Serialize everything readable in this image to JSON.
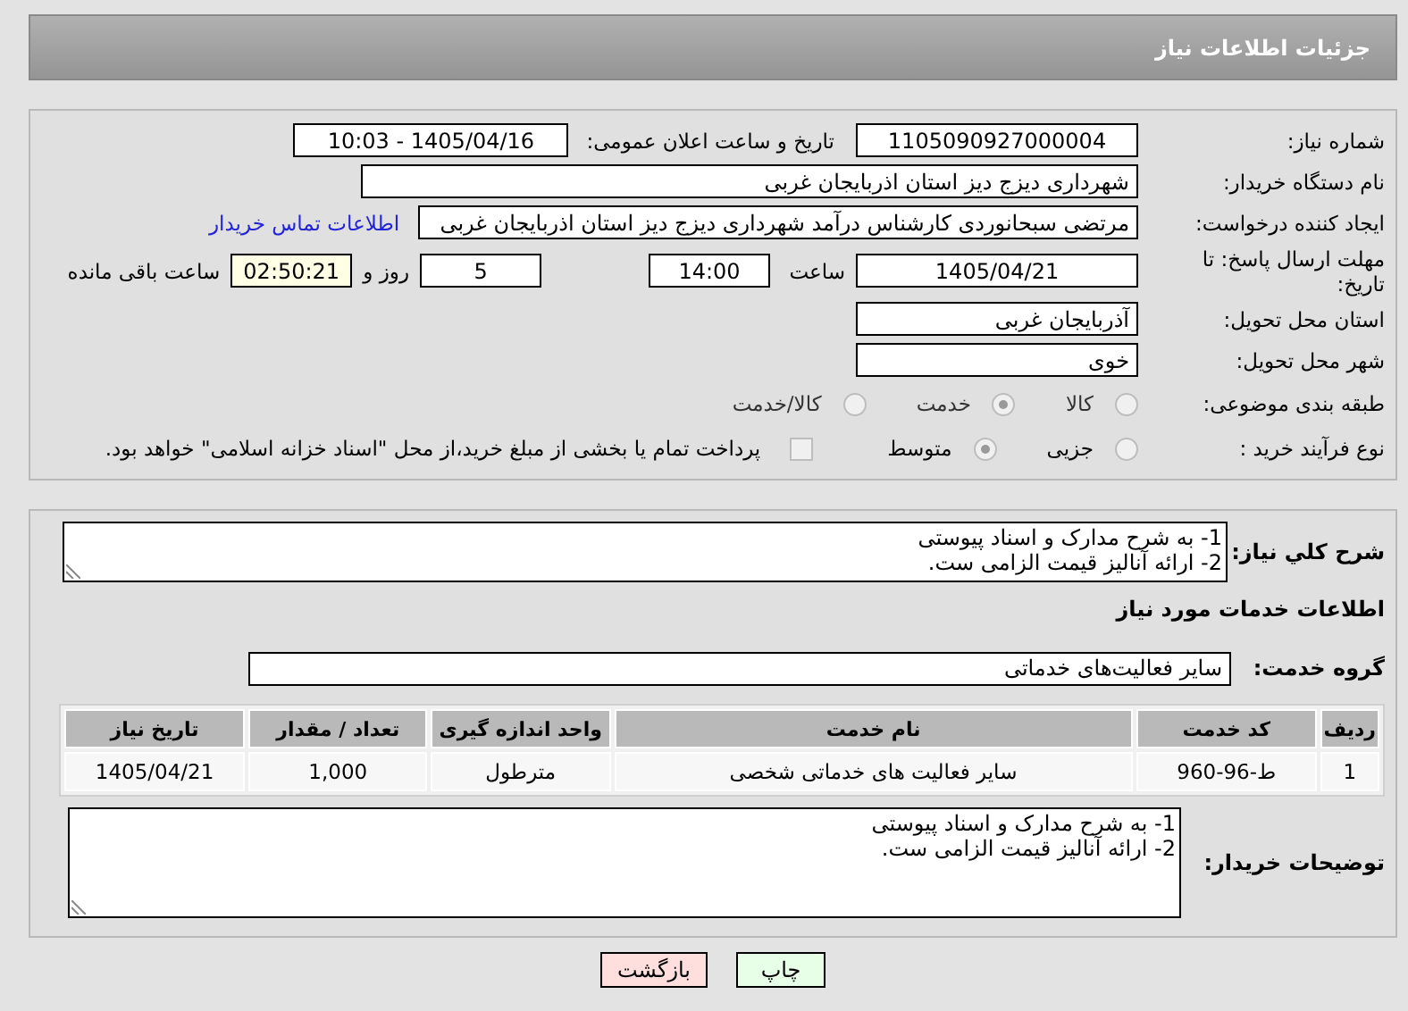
{
  "header": {
    "title": "جزئیات اطلاعات نیاز"
  },
  "need_number": {
    "label": "شماره نیاز:",
    "value": "1105090927000004"
  },
  "announce": {
    "label": "تاریخ و ساعت اعلان عمومی:",
    "value": "1405/04/16 - 10:03"
  },
  "buyer_org": {
    "label": "نام دستگاه خریدار:",
    "value": "شهرداری دیزج دیز استان اذربایجان غربی"
  },
  "creator": {
    "label": "ایجاد کننده درخواست:",
    "value": "مرتضی سبحانوردی کارشناس درآمد شهرداری دیزج دیز استان اذربایجان غربی",
    "link": "اطلاعات تماس خریدار"
  },
  "deadline": {
    "label": "مهلت ارسال پاسخ: تا تاریخ:",
    "date": "1405/04/21",
    "time_label": "ساعت",
    "time": "14:00",
    "days": "5",
    "days_label": "روز و",
    "remaining": "02:50:21",
    "remaining_label": "ساعت باقی مانده"
  },
  "province": {
    "label": "استان محل تحویل:",
    "value": "آذربایجان غربی"
  },
  "city": {
    "label": "شهر محل تحویل:",
    "value": "خوی"
  },
  "category": {
    "label": "طبقه بندی موضوعی:",
    "options": [
      {
        "label": "کالا",
        "selected": false
      },
      {
        "label": "خدمت",
        "selected": true
      },
      {
        "label": "کالا/خدمت",
        "selected": false
      }
    ]
  },
  "process": {
    "label": "نوع فرآیند خرید :",
    "options": [
      {
        "label": "جزیی",
        "selected": false
      },
      {
        "label": "متوسط",
        "selected": true
      }
    ],
    "payment": {
      "label": "پرداخت تمام یا بخشی از مبلغ خرید،از محل \"اسناد خزانه اسلامی\" خواهد بود.",
      "checked": false
    }
  },
  "summary": {
    "label": "شرح کلي نیاز:",
    "lines": [
      "1- به شرح مدارک و اسناد پیوستی",
      "2- ارائه آنالیز قیمت الزامی ست."
    ]
  },
  "services_heading": "اطلاعات خدمات مورد نیاز",
  "service_group": {
    "label": "گروه خدمت:",
    "value": "سایر فعالیت‌های خدماتی"
  },
  "table": {
    "columns": [
      "ردیف",
      "کد خدمت",
      "نام خدمت",
      "واحد اندازه گیری",
      "تعداد / مقدار",
      "تاریخ نیاز"
    ],
    "rows": [
      [
        "1",
        "ط-96-960",
        "سایر فعالیت های خدماتی شخصی",
        "مترطول",
        "1,000",
        "1405/04/21"
      ]
    ]
  },
  "buyer_notes": {
    "label": "توضیحات خریدار:",
    "lines": [
      "1- به شرح مدارک و اسناد پیوستی",
      "2- ارائه آنالیز قیمت الزامی ست."
    ]
  },
  "buttons": [
    {
      "label": "چاپ",
      "kind": "print"
    },
    {
      "label": "بازگشت",
      "kind": "back"
    }
  ]
}
